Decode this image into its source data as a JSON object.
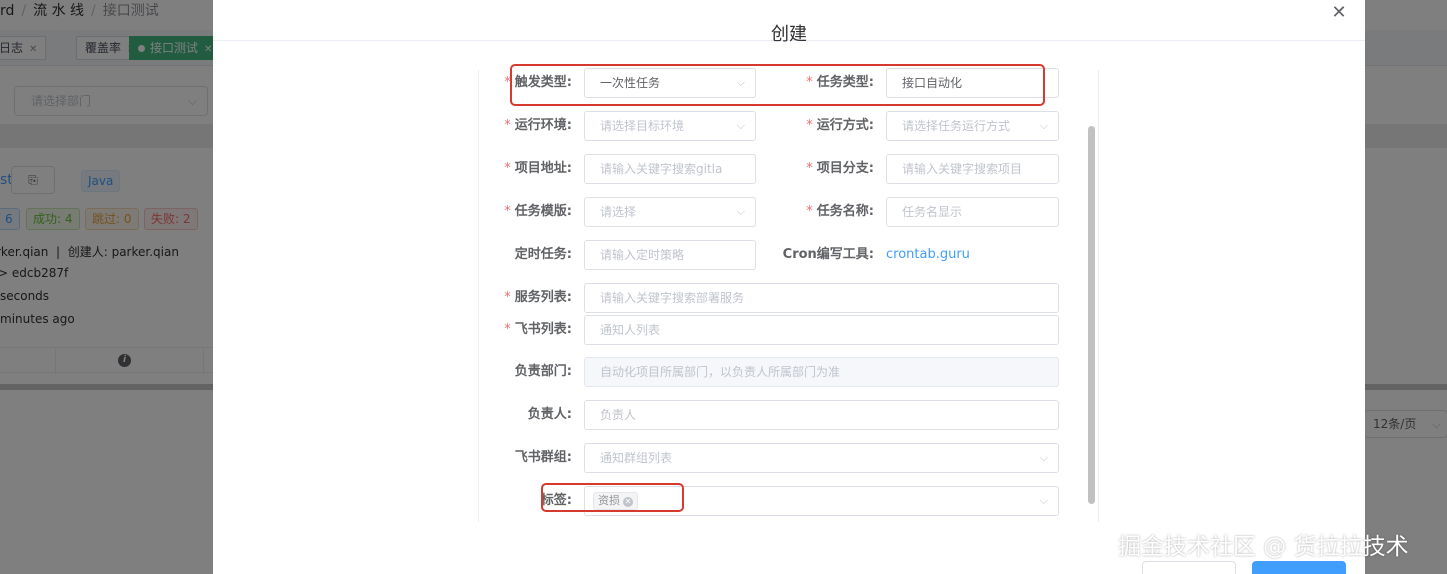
{
  "background": {
    "breadcrumb": [
      "rd",
      "流 水 线",
      "接口测试"
    ],
    "tabs": [
      {
        "label": "日志"
      },
      {
        "label": "覆盖率"
      },
      {
        "label": "接口测试",
        "active": true
      }
    ],
    "dept_filter_placeholder": "请选择部门",
    "project_name_fragment": "st",
    "lang_tag": "Java",
    "stats": {
      "total": "6",
      "success": "成功: 4",
      "skipped": "跳过: 0",
      "failed": "失败: 2"
    },
    "meta": {
      "owner": "rker.qian",
      "creator": "创建人: parker.qian",
      "commit": "> edcb287f",
      "duration": "seconds",
      "time": "minutes ago"
    },
    "page_size": "12条/页"
  },
  "dialog": {
    "title": "创建",
    "close_icon": "close-icon",
    "fields": {
      "trigger_type": {
        "label": "触发类型:",
        "value": "一次性任务",
        "required": true
      },
      "task_type": {
        "label": "任务类型:",
        "value": "接口自动化",
        "required": true
      },
      "env": {
        "label": "运行环境:",
        "placeholder": "请选择目标环境",
        "required": true
      },
      "run_mode": {
        "label": "运行方式:",
        "placeholder": "请选择任务运行方式",
        "required": true
      },
      "project_url": {
        "label": "项目地址:",
        "placeholder": "请输入关键字搜索gitla",
        "required": true
      },
      "project_branch": {
        "label": "项目分支:",
        "placeholder": "请输入关键字搜索项目",
        "required": true
      },
      "template": {
        "label": "任务模版:",
        "placeholder": "请选择",
        "required": true
      },
      "task_name": {
        "label": "任务名称:",
        "placeholder": "任务名显示",
        "required": true
      },
      "cron": {
        "label": "定时任务:",
        "placeholder": "请输入定时策略"
      },
      "cron_tool": {
        "label": "Cron编写工具:",
        "link": "crontab.guru"
      },
      "services": {
        "label": "服务列表:",
        "placeholder": "请输入关键字搜索部署服务",
        "required": true
      },
      "feishu_list": {
        "label": "飞书列表:",
        "placeholder": "通知人列表",
        "required": true
      },
      "dept": {
        "label": "负责部门:",
        "placeholder": "自动化项目所属部门，以负责人所属部门为准"
      },
      "owner": {
        "label": "负责人:",
        "placeholder": "负责人"
      },
      "feishu_group": {
        "label": "飞书群组:",
        "placeholder": "通知群组列表"
      },
      "tags": {
        "label": "标签:",
        "tag": "资损"
      }
    }
  },
  "watermark": "掘金技术社区 @ 货拉拉技术",
  "colors": {
    "accent": "#409eff",
    "highlight": "#d63a2f",
    "success": "#42b983"
  }
}
